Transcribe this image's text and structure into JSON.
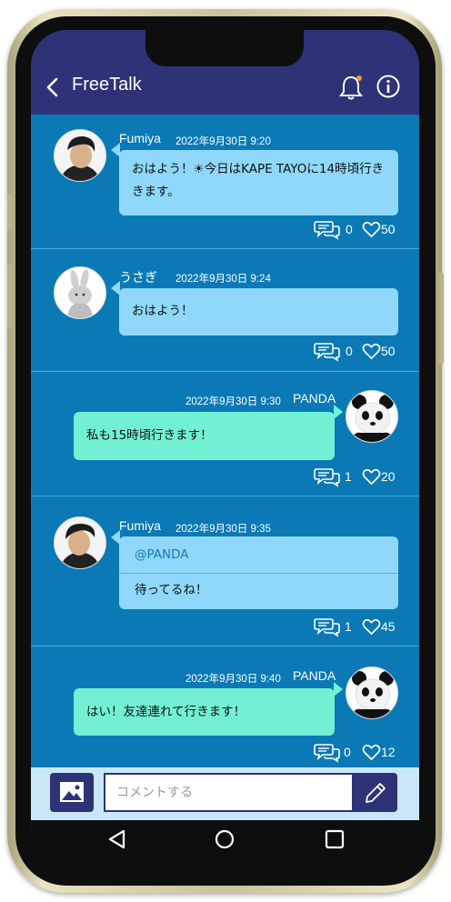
{
  "header": {
    "title": "FreeTalk"
  },
  "messages": [
    {
      "user": "Fumiya",
      "time": "2022年9月30日 9:20",
      "side": "left",
      "lines": [
        "おはよう！☀今日はKAPE TAYOに14時頃行き",
        "きます。"
      ],
      "comments": "0",
      "likes": "50"
    },
    {
      "user": "うさぎ",
      "time": "2022年9月30日 9:24",
      "side": "left",
      "lines": [
        "おはよう！"
      ],
      "comments": "0",
      "likes": "50"
    },
    {
      "user": "PANDA",
      "time": "2022年9月30日 9:30",
      "side": "right",
      "lines": [
        "私も15時頃行きます！"
      ],
      "comments": "1",
      "likes": "20"
    },
    {
      "user": "Fumiya",
      "time": "2022年9月30日 9:35",
      "side": "left",
      "mention": "@PANDA",
      "lines": [
        "待ってるね！"
      ],
      "comments": "1",
      "likes": "45"
    },
    {
      "user": "PANDA",
      "time": "2022年9月30日 9:40",
      "side": "right",
      "lines": [
        "はい！友達連れて行きます！"
      ],
      "comments": "0",
      "likes": "12"
    }
  ],
  "composer": {
    "placeholder": "コメントする"
  },
  "icons": {
    "back": "chevron-left-icon",
    "bell": "bell-icon",
    "info": "info-icon",
    "comment": "comment-bubbles-icon",
    "like": "heart-icon",
    "image": "image-icon",
    "send": "pencil-icon",
    "nav_back": "triangle-back-icon",
    "nav_home": "circle-home-icon",
    "nav_recent": "square-recent-icon"
  },
  "colors": {
    "header": "#2e3277",
    "chat_bg": "#0a79b6",
    "bubble_left": "#8fd8fb",
    "bubble_right": "#72f0d4",
    "notification_dot": "#f29a33"
  }
}
